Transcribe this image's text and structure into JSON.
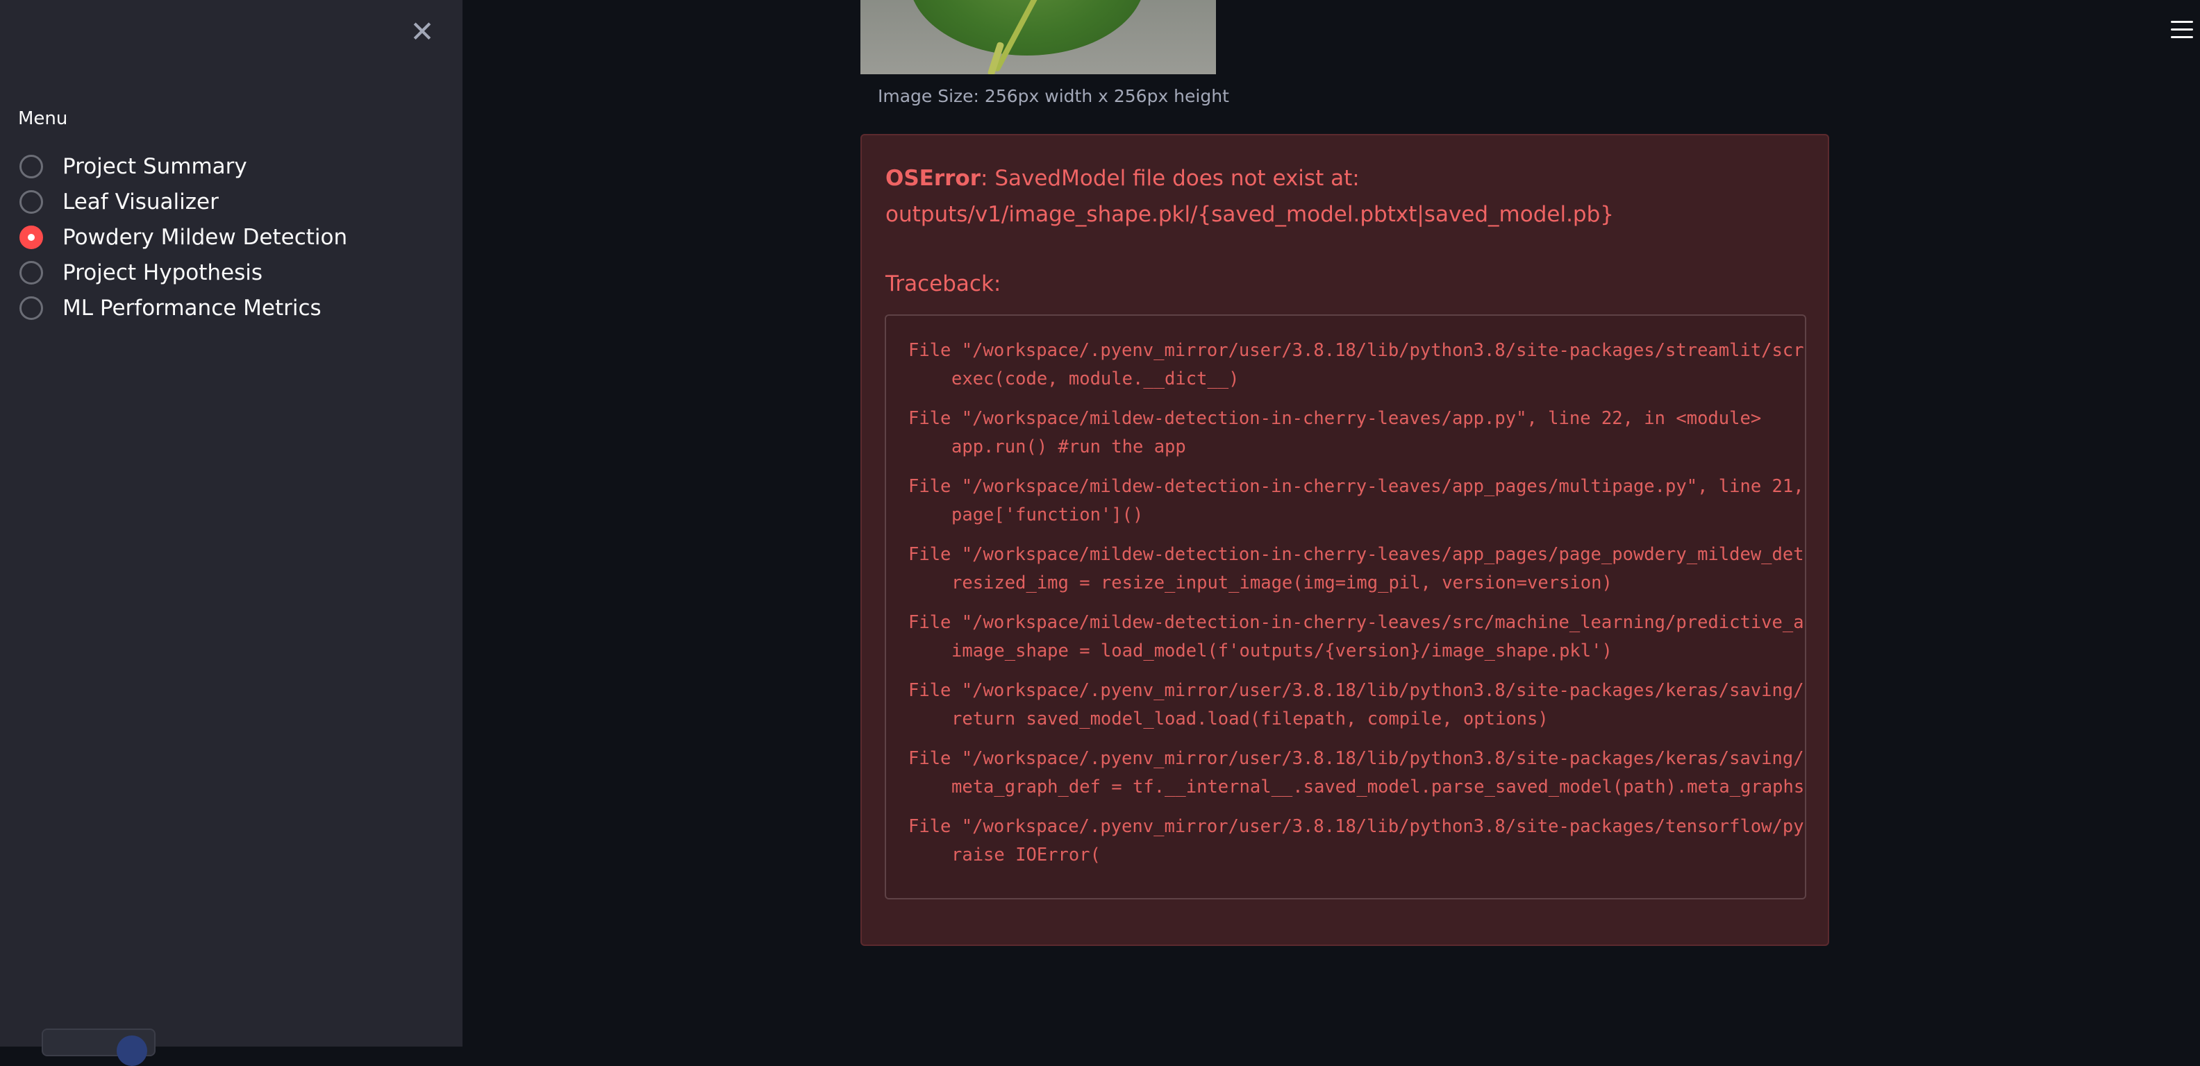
{
  "sidebar": {
    "close_icon": "close-icon",
    "menu_label": "Menu",
    "items": [
      {
        "label": "Project Summary",
        "selected": false
      },
      {
        "label": "Leaf Visualizer",
        "selected": false
      },
      {
        "label": "Powdery Mildew Detection",
        "selected": true
      },
      {
        "label": "Project Hypothesis",
        "selected": false
      },
      {
        "label": "ML Performance Metrics",
        "selected": false
      }
    ],
    "accent_color": "#ff4b4b"
  },
  "header": {
    "menu_icon": "hamburger-menu-icon"
  },
  "main": {
    "image_caption": "Image Size: 256px width x 256px height",
    "error": {
      "type": "OSError",
      "message": ": SavedModel file does not exist at:",
      "path": "outputs/v1/image_shape.pkl/{saved_model.pbtxt|saved_model.pb}",
      "traceback_label": "Traceback:",
      "frames": [
        {
          "file": "File \"/workspace/.pyenv_mirror/user/3.8.18/lib/python3.8/site-packages/streamlit/scr",
          "code": "exec(code, module.__dict__)"
        },
        {
          "file": "File \"/workspace/mildew-detection-in-cherry-leaves/app.py\", line 22, in <module>",
          "code": "app.run() #run the app"
        },
        {
          "file": "File \"/workspace/mildew-detection-in-cherry-leaves/app_pages/multipage.py\", line 21,",
          "code": "page['function']()"
        },
        {
          "file": "File \"/workspace/mildew-detection-in-cherry-leaves/app_pages/page_powdery_mildew_det",
          "code": "resized_img = resize_input_image(img=img_pil, version=version)"
        },
        {
          "file": "File \"/workspace/mildew-detection-in-cherry-leaves/src/machine_learning/predictive_a",
          "code": "image_shape = load_model(f'outputs/{version}/image_shape.pkl')"
        },
        {
          "file": "File \"/workspace/.pyenv_mirror/user/3.8.18/lib/python3.8/site-packages/keras/saving/",
          "code": "return saved_model_load.load(filepath, compile, options)"
        },
        {
          "file": "File \"/workspace/.pyenv_mirror/user/3.8.18/lib/python3.8/site-packages/keras/saving/",
          "code": "meta_graph_def = tf.__internal__.saved_model.parse_saved_model(path).meta_graphs"
        },
        {
          "file": "File \"/workspace/.pyenv_mirror/user/3.8.18/lib/python3.8/site-packages/tensorflow/py",
          "code": "raise IOError("
        }
      ]
    }
  }
}
